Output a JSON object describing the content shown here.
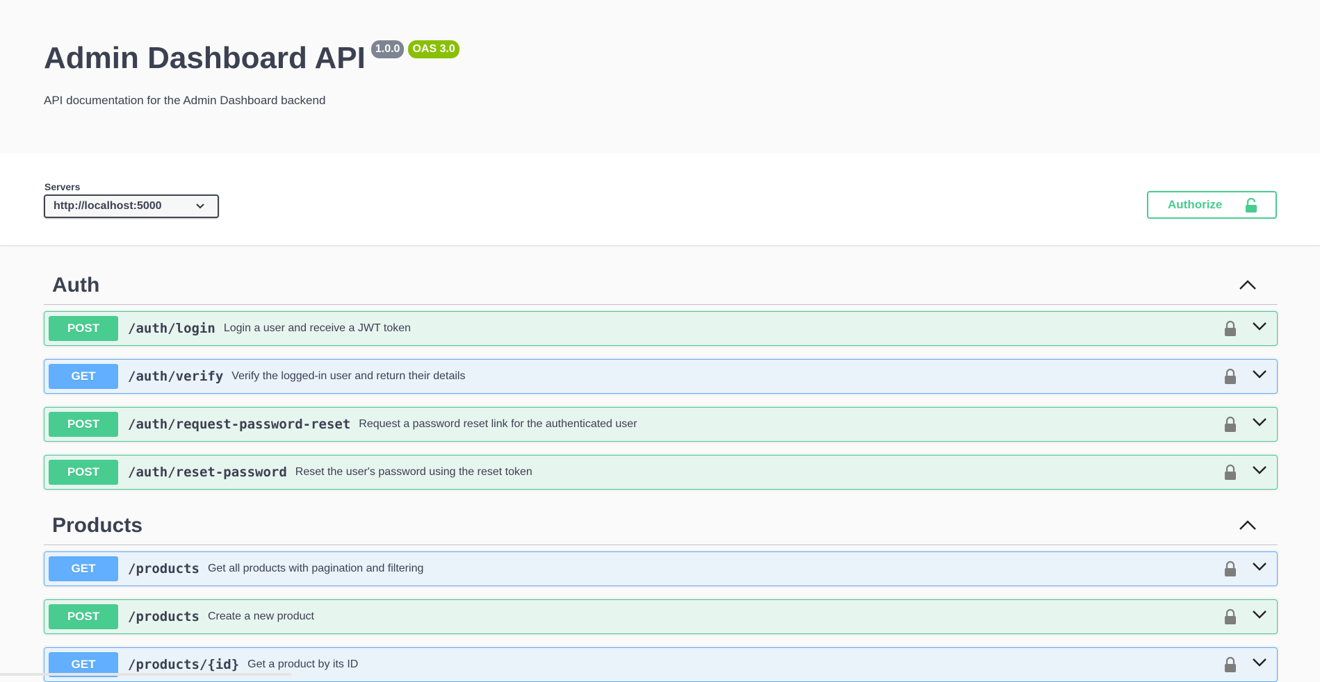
{
  "info": {
    "title": "Admin Dashboard API",
    "version_badge": "1.0.0",
    "oas_badge": "OAS 3.0",
    "description": "API documentation for the Admin Dashboard backend"
  },
  "servers": {
    "label": "Servers",
    "selected": "http://localhost:5000"
  },
  "authorize_label": "Authorize",
  "colors": {
    "post": "#49cc90",
    "get": "#61affe",
    "text": "#3b4151"
  },
  "tags": [
    {
      "name": "Auth",
      "operations": [
        {
          "method": "POST",
          "path": "/auth/login",
          "summary": "Login a user and receive a JWT token"
        },
        {
          "method": "GET",
          "path": "/auth/verify",
          "summary": "Verify the logged-in user and return their details"
        },
        {
          "method": "POST",
          "path": "/auth/request-password-reset",
          "summary": "Request a password reset link for the authenticated user"
        },
        {
          "method": "POST",
          "path": "/auth/reset-password",
          "summary": "Reset the user's password using the reset token"
        }
      ]
    },
    {
      "name": "Products",
      "operations": [
        {
          "method": "GET",
          "path": "/products",
          "summary": "Get all products with pagination and filtering"
        },
        {
          "method": "POST",
          "path": "/products",
          "summary": "Create a new product"
        },
        {
          "method": "GET",
          "path": "/products/{id}",
          "summary": "Get a product by its ID"
        }
      ]
    }
  ]
}
